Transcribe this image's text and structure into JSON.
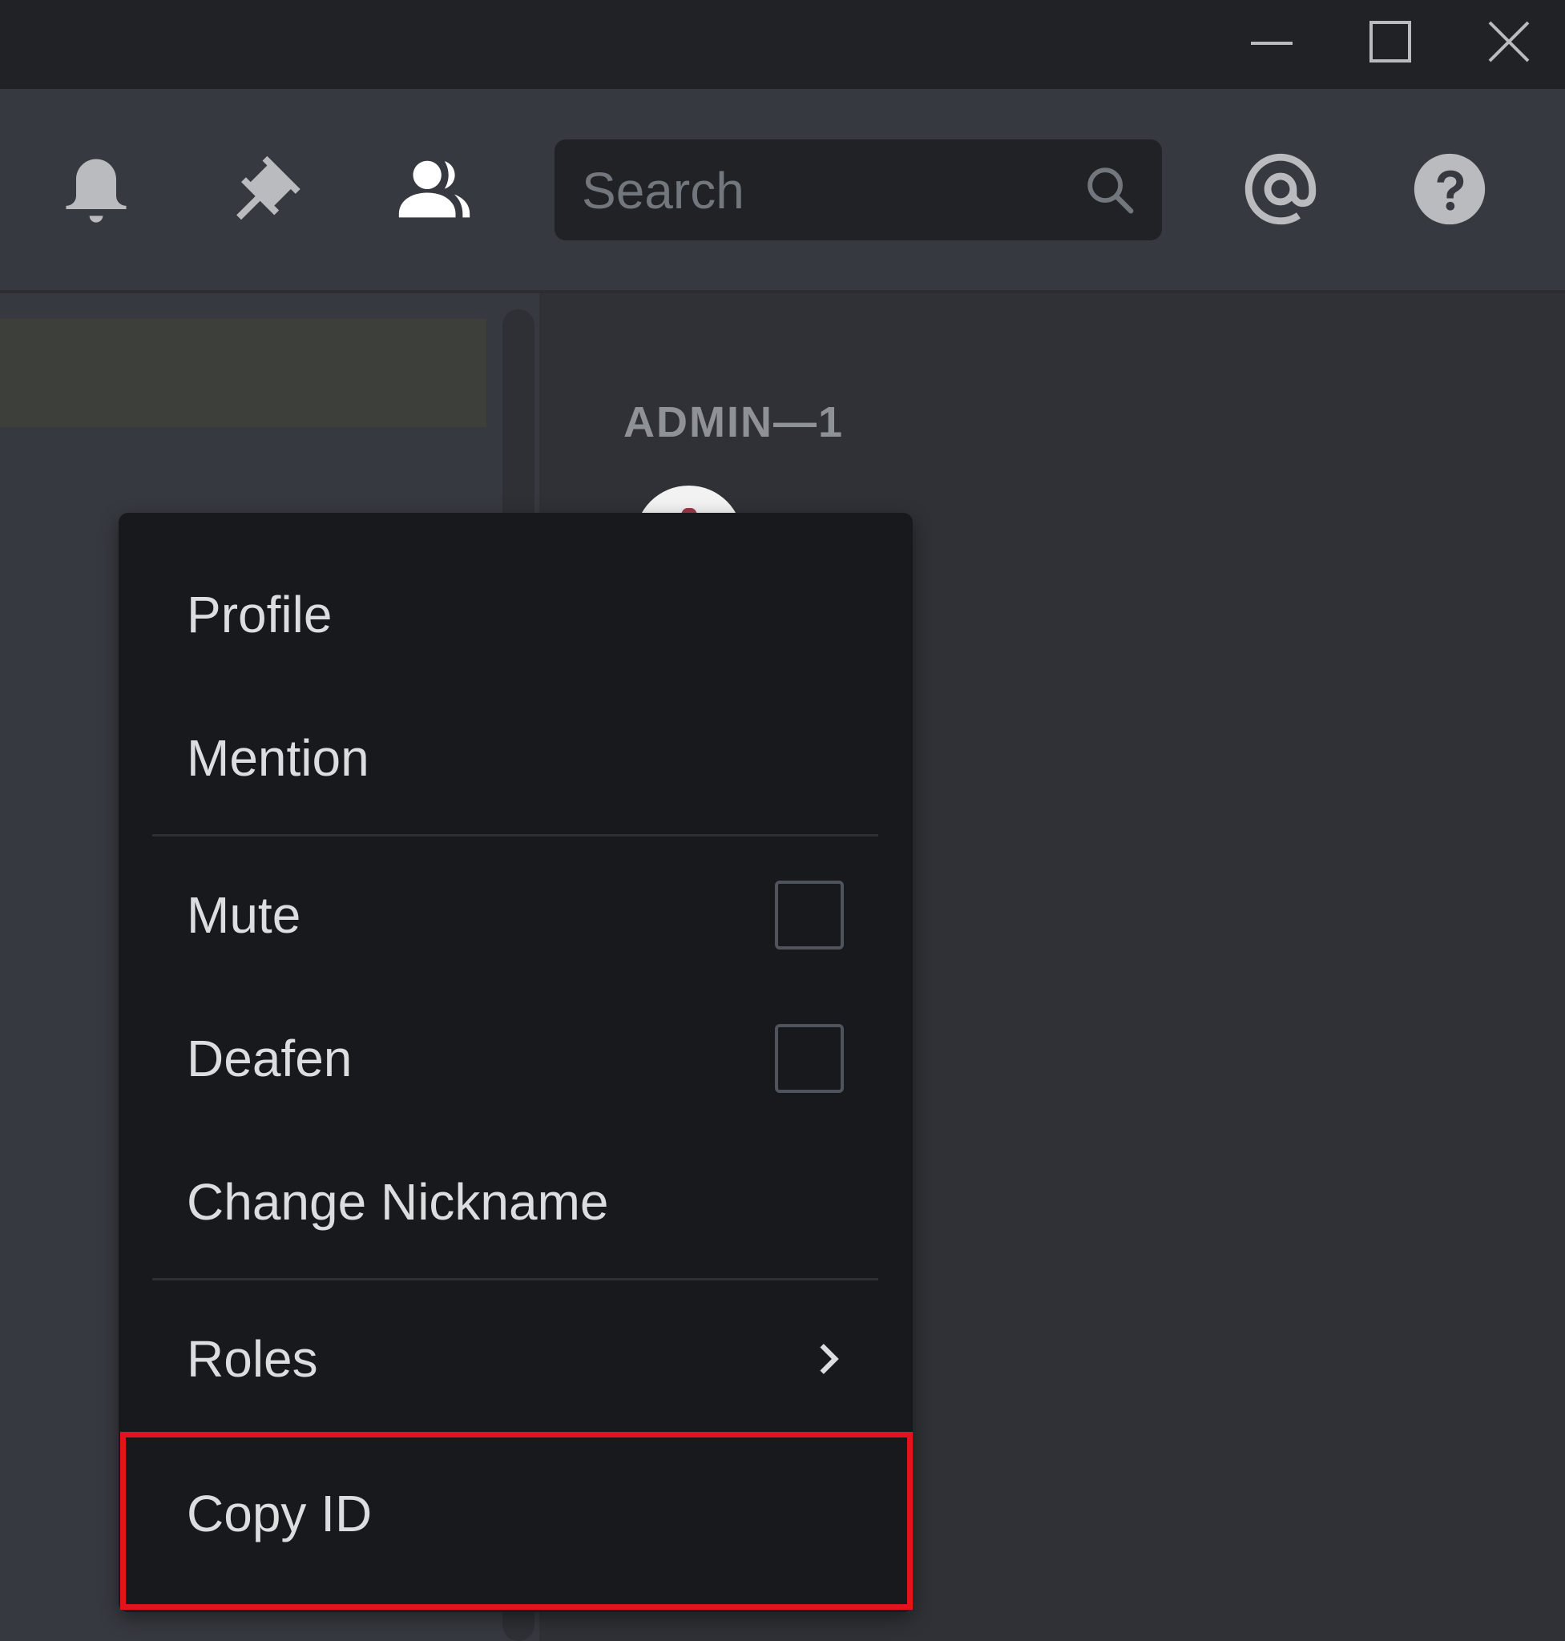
{
  "window_controls": {
    "minimize_icon": "minimize-icon",
    "maximize_icon": "maximize-icon",
    "close_icon": "close-icon"
  },
  "toolbar": {
    "icons": [
      "bell-icon",
      "pin-icon",
      "members-icon",
      "at-mention-icon",
      "help-icon"
    ],
    "search": {
      "placeholder": "Search",
      "value": ""
    }
  },
  "members": {
    "role_header": "ADMIN—1"
  },
  "context_menu": {
    "items": [
      {
        "label": "Profile",
        "type": "action"
      },
      {
        "label": "Mention",
        "type": "action"
      },
      {
        "label": "Mute",
        "type": "checkbox",
        "checked": false
      },
      {
        "label": "Deafen",
        "type": "checkbox",
        "checked": false
      },
      {
        "label": "Change Nickname",
        "type": "action"
      },
      {
        "label": "Roles",
        "type": "submenu"
      },
      {
        "label": "Copy ID",
        "type": "action",
        "highlighted": true
      }
    ]
  },
  "colors": {
    "titlebar": "#202225",
    "toolbar": "#36393f",
    "menu_bg": "#18191c",
    "menu_text": "#dcddde",
    "highlight_box": "#e3131b"
  }
}
